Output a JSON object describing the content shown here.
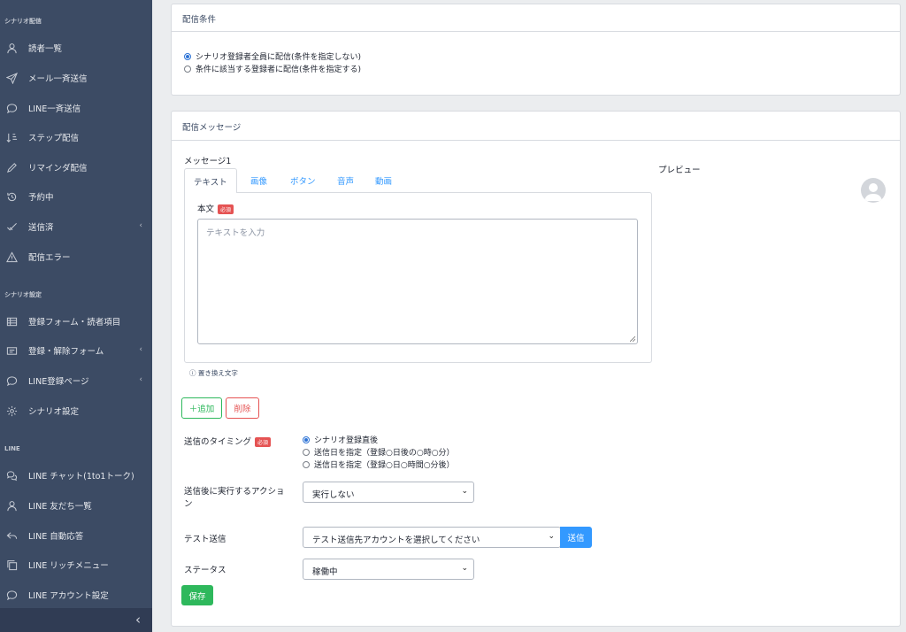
{
  "sidebar": {
    "section1": "シナリオ配信",
    "section2": "シナリオ設定",
    "section3": "LINE",
    "items": [
      {
        "label": "読者一覧",
        "icon": "user-icon"
      },
      {
        "label": "メール一斉送信",
        "icon": "send-icon"
      },
      {
        "label": "LINE一斉送信",
        "icon": "chat-icon"
      },
      {
        "label": "ステップ配信",
        "icon": "sort-icon"
      },
      {
        "label": "リマインダ配信",
        "icon": "pencil-icon"
      },
      {
        "label": "予約中",
        "icon": "history-icon"
      },
      {
        "label": "送信済",
        "icon": "check-icon"
      },
      {
        "label": "配信エラー",
        "icon": "warning-icon"
      },
      {
        "label": "登録フォーム・読者項目",
        "icon": "table-icon"
      },
      {
        "label": "登録・解除フォーム",
        "icon": "form-icon"
      },
      {
        "label": "LINE登録ページ",
        "icon": "chat-icon"
      },
      {
        "label": "シナリオ設定",
        "icon": "gear-icon"
      },
      {
        "label": "LINE チャット(1to1トーク)",
        "icon": "chat-bubbles-icon"
      },
      {
        "label": "LINE 友だち一覧",
        "icon": "user-icon"
      },
      {
        "label": "LINE 自動応答",
        "icon": "reply-icon"
      },
      {
        "label": "LINE リッチメニュー",
        "icon": "copy-icon"
      },
      {
        "label": "LINE アカウント設定",
        "icon": "chat-icon"
      }
    ],
    "chevron": "‹"
  },
  "conditions": {
    "title": "配信条件",
    "options": [
      "シナリオ登録者全員に配信(条件を指定しない)",
      "条件に該当する登録者に配信(条件を指定する)"
    ],
    "selected": 0
  },
  "message": {
    "title": "配信メッセージ",
    "message_label": "メッセージ1",
    "preview_label": "プレビュー",
    "tabs": [
      "テキスト",
      "画像",
      "ボタン",
      "音声",
      "動画"
    ],
    "active_tab": 0,
    "body_label": "本文",
    "required": "必須",
    "textarea_placeholder": "テキストを入力",
    "replace_text": "置き換え文字",
    "add_button": "＋追加",
    "delete_button": "削除",
    "timing_label": "送信のタイミング",
    "timing_options": [
      "シナリオ登録直後",
      "送信日を指定（登録○日後の○時○分）",
      "送信日を指定（登録○日○時間○分後）"
    ],
    "timing_selected": 0,
    "action_label": "送信後に実行するアクション",
    "action_value": "実行しない",
    "test_label": "テスト送信",
    "test_value": "テスト送信先アカウントを選択してください",
    "send_button": "送信",
    "status_label": "ステータス",
    "status_value": "稼働中",
    "save_button": "保存"
  },
  "colors": {
    "sidebar": "#3c4b64",
    "primary": "#3399ff",
    "success": "#2eb85c",
    "danger": "#e55353"
  }
}
